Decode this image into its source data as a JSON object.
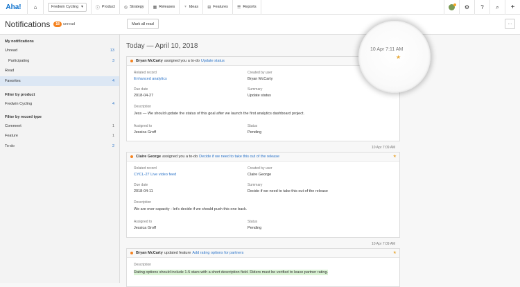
{
  "topbar": {
    "logo": "Aha!",
    "workspace": "Fredwin Cycling",
    "nav": [
      {
        "label": "Product",
        "icon": "info-icon"
      },
      {
        "label": "Strategy",
        "icon": "target-icon"
      },
      {
        "label": "Releases",
        "icon": "calendar-icon"
      },
      {
        "label": "Ideas",
        "icon": "lightbulb-icon"
      },
      {
        "label": "Features",
        "icon": "grid-icon"
      },
      {
        "label": "Reports",
        "icon": "report-icon"
      }
    ]
  },
  "header": {
    "title": "Notifications",
    "unread_count": "18",
    "unread_label": "unread",
    "mark_all_read": "Mark all read",
    "more": "···"
  },
  "sidebar": {
    "my_notifications": "My notifications",
    "items": [
      {
        "label": "Unread",
        "count": "13"
      },
      {
        "label": "Participating",
        "count": "3"
      },
      {
        "label": "Read",
        "count": ""
      },
      {
        "label": "Favorites",
        "count": "4"
      }
    ],
    "filter_product": "Filter by product",
    "products": [
      {
        "label": "Fredwin Cycling",
        "count": "4"
      }
    ],
    "filter_record": "Filter by record type",
    "record_types": [
      {
        "label": "Comment",
        "count": "1"
      },
      {
        "label": "Feature",
        "count": "1"
      },
      {
        "label": "To-do",
        "count": "2"
      }
    ]
  },
  "main": {
    "day_title": "Today — April 10, 2018",
    "magnified_timestamp": "10 Apr 7:11 AM",
    "notifications": [
      {
        "timestamp": "",
        "who": "Bryan McCarty",
        "action": "assigned you a to-do",
        "link": "Update status",
        "related_record_label": "Related record",
        "related_record": "Enhanced analytics",
        "created_by_label": "Created by user",
        "created_by": "Bryan McCarty",
        "due_date_label": "Due date",
        "due_date": "2018-04-27",
        "summary_label": "Summary",
        "summary": "Update status",
        "description_label": "Description",
        "description": "Jess — We should update the status of this goal after we launch the first analytics dashboard project.",
        "assigned_to_label": "Assigned to",
        "assigned_to": "Jessica Groff",
        "status_label": "Status",
        "status": "Pending"
      },
      {
        "timestamp": "10 Apr 7:09 AM",
        "who": "Claire George",
        "action": "assigned you a to-do",
        "link": "Decide if we need to take this out of the release",
        "related_record_label": "Related record",
        "related_record": "CYCL-27 Live video feed",
        "created_by_label": "Created by user",
        "created_by": "Claire George",
        "due_date_label": "Due date",
        "due_date": "2018-04-11",
        "summary_label": "Summary",
        "summary": "Decide if we need to take this out of the release",
        "description_label": "Description",
        "description": "We are over capacity - let's decide if we should push this one back.",
        "assigned_to_label": "Assigned to",
        "assigned_to": "Jessica Groff",
        "status_label": "Status",
        "status": "Pending"
      },
      {
        "timestamp": "10 Apr 7:09 AM",
        "who": "Bryan McCarty",
        "action": "updated feature",
        "link": "Add rating options for partners",
        "description_label": "Description",
        "description": "Rating options should include 1-5 stars with a short description field. Riders must be verified to leave partner rating."
      }
    ]
  }
}
